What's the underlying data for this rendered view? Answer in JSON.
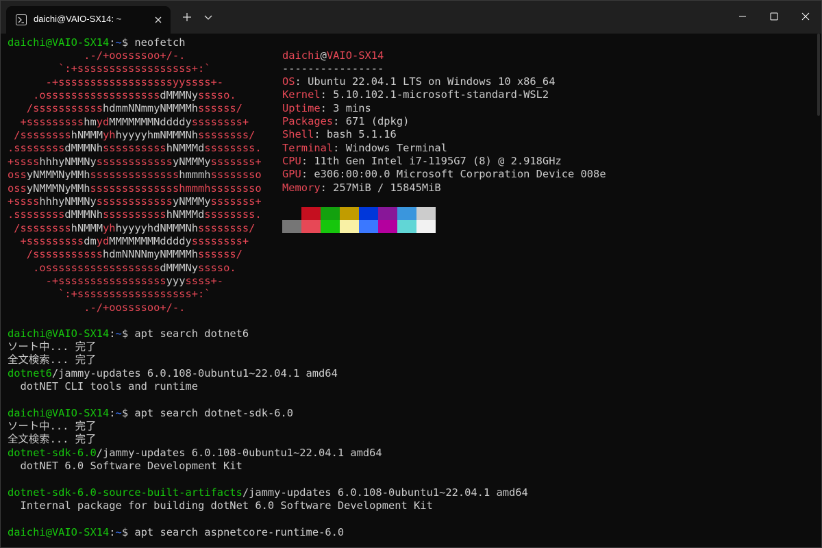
{
  "window": {
    "tab_title": "daichi@VAIO-SX14: ~",
    "icons": {
      "tab": "powershell-icon",
      "close_tab": "close-icon",
      "new_tab": "plus-icon",
      "dropdown": "chevron-down-icon",
      "minimize": "minimize-icon",
      "maximize": "maximize-icon",
      "close": "close-icon"
    }
  },
  "colors": {
    "background": "#0c0c0c",
    "prompt_user": "#16c60c",
    "prompt_path": "#3b78ff",
    "ascii_art": "#e74856",
    "text": "#cccccc"
  },
  "prompt": {
    "user_host": "daichi@VAIO-SX14",
    "colon": ":",
    "path": "~",
    "dollar": "$ "
  },
  "commands": {
    "neofetch": "neofetch",
    "apt1": "apt search dotnet6",
    "apt2": "apt search dotnet-sdk-6.0",
    "apt3": "apt search aspnetcore-runtime-6.0"
  },
  "neofetch": {
    "logo": [
      [
        {
          "t": "            .-/+oossssoo+/-.",
          "c": "r"
        }
      ],
      [
        {
          "t": "        `:+ssssssssssssssssss+:`",
          "c": "r"
        }
      ],
      [
        {
          "t": "      -+ssssssssssssssssssyyssss+-",
          "c": "r"
        }
      ],
      [
        {
          "t": "    .ossssssssssssssssss",
          "c": "r"
        },
        {
          "t": "dMMMNy",
          "c": "w"
        },
        {
          "t": "sssso.",
          "c": "r"
        }
      ],
      [
        {
          "t": "   /sssssssssss",
          "c": "r"
        },
        {
          "t": "hdmmNNmmyNMMMMh",
          "c": "w"
        },
        {
          "t": "ssssss/",
          "c": "r"
        }
      ],
      [
        {
          "t": "  +sssssssss",
          "c": "r"
        },
        {
          "t": "hm",
          "c": "w"
        },
        {
          "t": "yd",
          "c": "r"
        },
        {
          "t": "MMMMMMMNddddy",
          "c": "w"
        },
        {
          "t": "ssssssss+",
          "c": "r"
        }
      ],
      [
        {
          "t": " /ssssssss",
          "c": "r"
        },
        {
          "t": "hNMMM",
          "c": "w"
        },
        {
          "t": "yh",
          "c": "r"
        },
        {
          "t": "hyyyyhmNMMMNh",
          "c": "w"
        },
        {
          "t": "ssssssss/",
          "c": "r"
        }
      ],
      [
        {
          "t": ".ssssssss",
          "c": "r"
        },
        {
          "t": "dMMMNh",
          "c": "w"
        },
        {
          "t": "ssssssssss",
          "c": "r"
        },
        {
          "t": "hNMMMd",
          "c": "w"
        },
        {
          "t": "ssssssss.",
          "c": "r"
        }
      ],
      [
        {
          "t": "+ssss",
          "c": "r"
        },
        {
          "t": "hhhyNMMNy",
          "c": "w"
        },
        {
          "t": "ssssssssssss",
          "c": "r"
        },
        {
          "t": "yNMMMy",
          "c": "w"
        },
        {
          "t": "sssssss+",
          "c": "r"
        }
      ],
      [
        {
          "t": "oss",
          "c": "r"
        },
        {
          "t": "yNMMMNyMMh",
          "c": "w"
        },
        {
          "t": "ssssssssssssss",
          "c": "r"
        },
        {
          "t": "hmmmh",
          "c": "w"
        },
        {
          "t": "ssssssso",
          "c": "r"
        }
      ],
      [
        {
          "t": "oss",
          "c": "r"
        },
        {
          "t": "yNMMMNyMMh",
          "c": "w"
        },
        {
          "t": "sssssssssssssshmmmhssssssso",
          "c": "r"
        }
      ],
      [
        {
          "t": "+ssss",
          "c": "r"
        },
        {
          "t": "hhhyNMMNy",
          "c": "w"
        },
        {
          "t": "ssssssssssss",
          "c": "r"
        },
        {
          "t": "yNMMMy",
          "c": "w"
        },
        {
          "t": "sssssss+",
          "c": "r"
        }
      ],
      [
        {
          "t": ".ssssssss",
          "c": "r"
        },
        {
          "t": "dMMMNh",
          "c": "w"
        },
        {
          "t": "ssssssssss",
          "c": "r"
        },
        {
          "t": "hNMMMd",
          "c": "w"
        },
        {
          "t": "ssssssss.",
          "c": "r"
        }
      ],
      [
        {
          "t": " /ssssssss",
          "c": "r"
        },
        {
          "t": "hNMMM",
          "c": "w"
        },
        {
          "t": "yh",
          "c": "r"
        },
        {
          "t": "hyyyyhdNMMMNh",
          "c": "w"
        },
        {
          "t": "ssssssss/",
          "c": "r"
        }
      ],
      [
        {
          "t": "  +sssssssss",
          "c": "r"
        },
        {
          "t": "dm",
          "c": "w"
        },
        {
          "t": "yd",
          "c": "r"
        },
        {
          "t": "MMMMMMMMddddy",
          "c": "w"
        },
        {
          "t": "ssssssss+",
          "c": "r"
        }
      ],
      [
        {
          "t": "   /sssssssssss",
          "c": "r"
        },
        {
          "t": "hdmNNNNmyNMMMMh",
          "c": "w"
        },
        {
          "t": "ssssss/",
          "c": "r"
        }
      ],
      [
        {
          "t": "    .ossssssssssssssssss",
          "c": "r"
        },
        {
          "t": "dMMMNy",
          "c": "w"
        },
        {
          "t": "sssso.",
          "c": "r"
        }
      ],
      [
        {
          "t": "      -+sssssssssssssssss",
          "c": "r"
        },
        {
          "t": "yyy",
          "c": "w"
        },
        {
          "t": "ssss+-",
          "c": "r"
        }
      ],
      [
        {
          "t": "        `:+ssssssssssssssssss+:`",
          "c": "r"
        }
      ],
      [
        {
          "t": "            .-/+oossssoo+/-.",
          "c": "r"
        }
      ]
    ],
    "header": {
      "user": "daichi",
      "at": "@",
      "host": "VAIO-SX14"
    },
    "separator": "----------------",
    "info": [
      {
        "label": "OS",
        "value": "Ubuntu 22.04.1 LTS on Windows 10 x86_64"
      },
      {
        "label": "Kernel",
        "value": "5.10.102.1-microsoft-standard-WSL2"
      },
      {
        "label": "Uptime",
        "value": "3 mins"
      },
      {
        "label": "Packages",
        "value": "671 (dpkg)"
      },
      {
        "label": "Shell",
        "value": "bash 5.1.16"
      },
      {
        "label": "Terminal",
        "value": "Windows Terminal"
      },
      {
        "label": "CPU",
        "value": "11th Gen Intel i7-1195G7 (8) @ 2.918GHz"
      },
      {
        "label": "GPU",
        "value": "e306:00:00.0 Microsoft Corporation Device 008e"
      },
      {
        "label": "Memory",
        "value": "257MiB / 15845MiB"
      }
    ],
    "palette_row1": [
      "#0c0c0c",
      "#c50f1f",
      "#13a10e",
      "#c19c00",
      "#0037da",
      "#881798",
      "#3a96dd",
      "#cccccc"
    ],
    "palette_row2": [
      "#767676",
      "#e74856",
      "#16c60c",
      "#f9f1a5",
      "#3b78ff",
      "#b4009e",
      "#61d6d6",
      "#f2f2f2"
    ]
  },
  "output": {
    "sorting": "ソート中... 完了",
    "fulltext": "全文検索... 完了",
    "pkg1": {
      "name": "dotnet6",
      "info": "/jammy-updates 6.0.108-0ubuntu1~22.04.1 amd64",
      "desc": "  dotNET CLI tools and runtime"
    },
    "pkg2": {
      "name": "dotnet-sdk-6.0",
      "info": "/jammy-updates 6.0.108-0ubuntu1~22.04.1 amd64",
      "desc": "  dotNET 6.0 Software Development Kit"
    },
    "pkg3": {
      "name": "dotnet-sdk-6.0-source-built-artifacts",
      "info": "/jammy-updates 6.0.108-0ubuntu1~22.04.1 amd64",
      "desc": "  Internal package for building dotNet 6.0 Software Development Kit"
    }
  }
}
